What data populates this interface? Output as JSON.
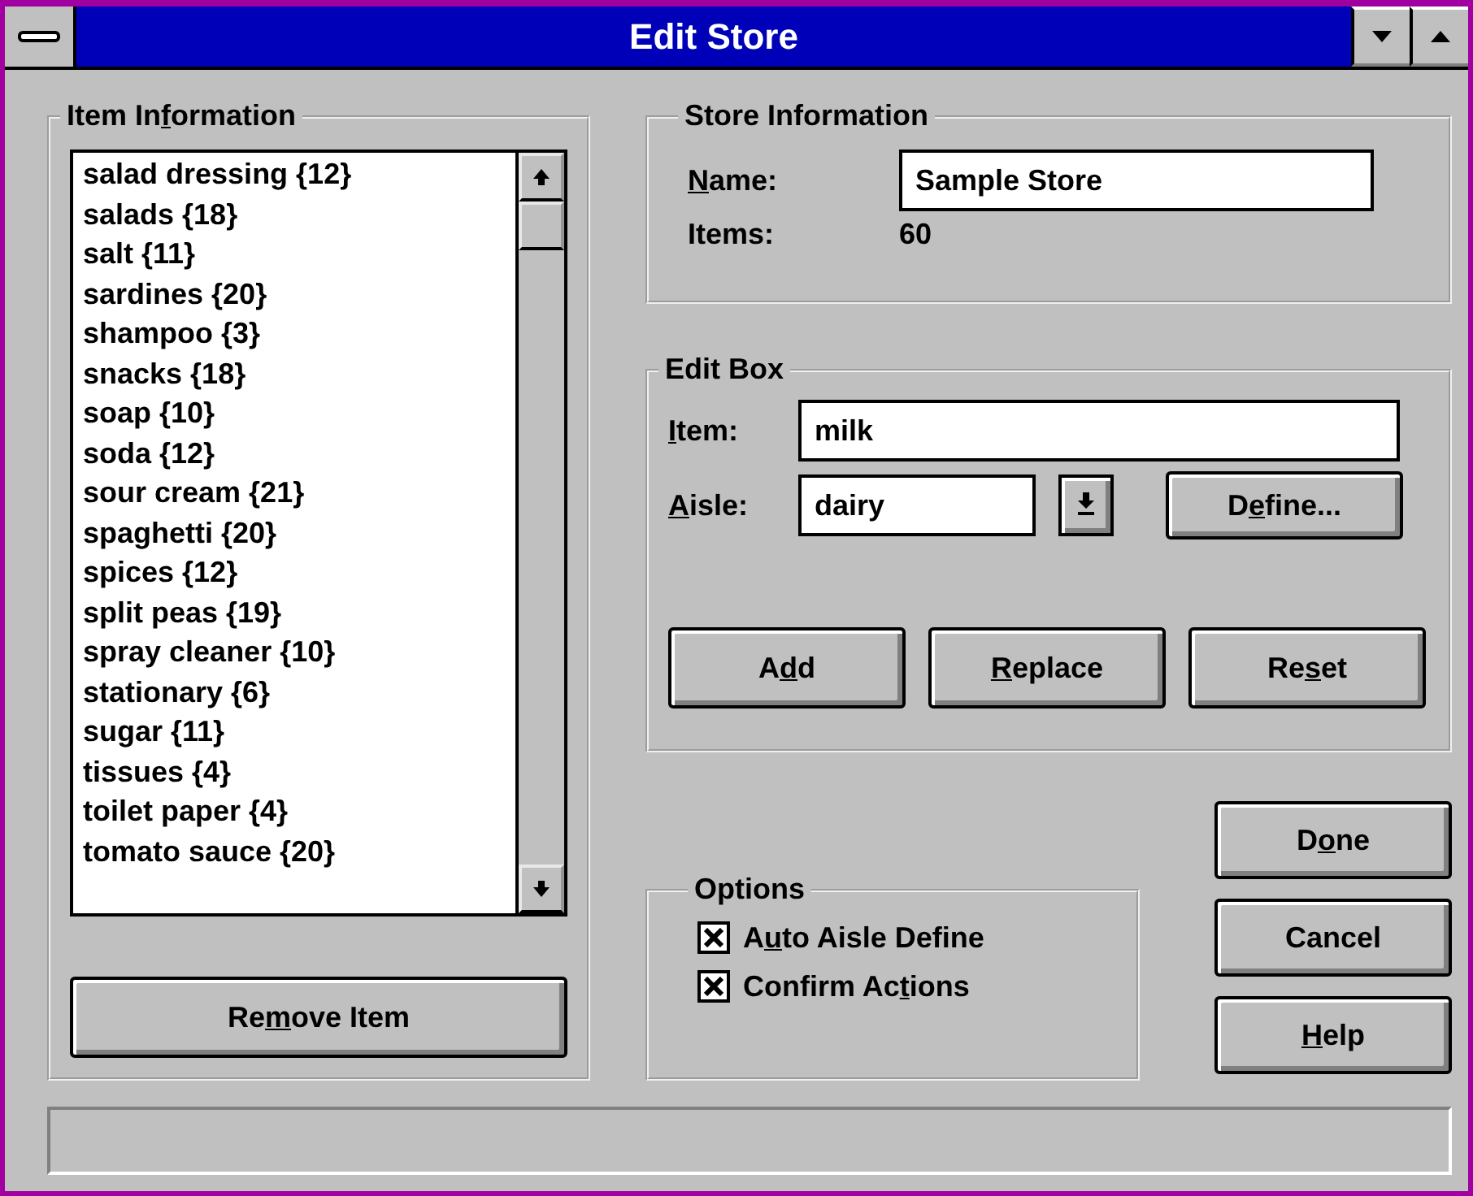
{
  "window": {
    "title": "Edit Store"
  },
  "item_information": {
    "title": {
      "pre": "Item In",
      "key": "f",
      "post": "ormation"
    },
    "items": [
      "salad dressing {12}",
      "salads {18}",
      "salt {11}",
      "sardines {20}",
      "shampoo {3}",
      "snacks {18}",
      "soap {10}",
      "soda {12}",
      "sour cream {21}",
      "spaghetti {20}",
      "spices {12}",
      "split peas {19}",
      "spray cleaner {10}",
      "stationary {6}",
      "sugar {11}",
      "tissues {4}",
      "toilet paper {4}",
      "tomato sauce {20}"
    ],
    "remove_button": {
      "pre": "Re",
      "key": "m",
      "post": "ove Item"
    }
  },
  "store_information": {
    "title": {
      "pre": "Store Information"
    },
    "name_label": {
      "key": "N",
      "post": "ame:"
    },
    "name_value": "Sample Store",
    "items_label": "Items:",
    "items_value": "60"
  },
  "edit_box": {
    "title": {
      "pre": "Edit Box"
    },
    "item_label": {
      "key": "I",
      "post": "tem:"
    },
    "item_value": "milk",
    "aisle_label": {
      "key": "A",
      "post": "isle:"
    },
    "aisle_value": "dairy",
    "define_button": {
      "pre": "D",
      "key": "e",
      "post": "fine..."
    },
    "buttons": [
      {
        "pre": "A",
        "key": "d",
        "post": "d"
      },
      {
        "key": "R",
        "post": "eplace"
      },
      {
        "pre": "Re",
        "key": "s",
        "post": "et"
      }
    ]
  },
  "options": {
    "title": {
      "pre": "Options"
    },
    "checkboxes": [
      {
        "label": {
          "pre": "A",
          "key": "u",
          "post": "to Aisle Define"
        },
        "checked": true
      },
      {
        "label": {
          "pre": "Confirm Ac",
          "key": "t",
          "post": "ions"
        },
        "checked": true
      }
    ]
  },
  "dialog_buttons": [
    {
      "pre": "D",
      "key": "o",
      "post": "ne"
    },
    {
      "pre": "Cancel"
    },
    {
      "key": "H",
      "post": "elp"
    }
  ]
}
